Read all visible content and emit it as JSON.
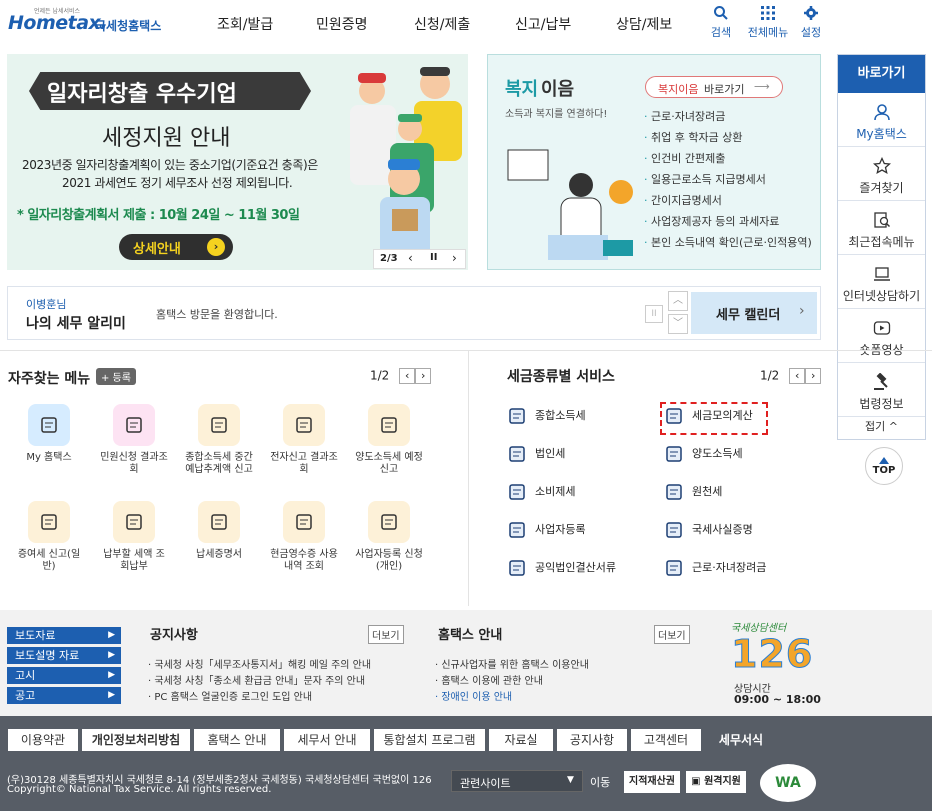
{
  "header": {
    "logo_sub": "언제든 납세서비스",
    "logo_main": "Hometax.",
    "logo_kr": "국세청홈택스",
    "gnb": [
      "조회/발급",
      "민원증명",
      "신청/제출",
      "신고/납부",
      "상담/제보"
    ],
    "util": [
      "검색",
      "전체메뉴",
      "설정"
    ]
  },
  "banner1": {
    "title": "일자리창출 우수기업",
    "subtitle": "세정지원 안내",
    "body_line1": "2023년중 일자리창출계획이 있는 중소기업(기준요건 충족)은",
    "body_line2": "2021 과세연도 정기 세무조사 선정 제외됩니다.",
    "deadline": "* 일자리창출계획서 제출 : 10월 24일 ~ 11월 30일",
    "button": "상세안내",
    "pager": "2/3"
  },
  "banner2": {
    "title_a": "복지",
    "title_b": "이음",
    "subtitle": "소득과 복지를 연결하다!",
    "link_a": "복지이음",
    "link_b": " 바로가기",
    "items": [
      "근로·자녀장려금",
      "취업 후 학자금 상환",
      "인건비 간편제출",
      "일용근로소득 지급명세서",
      "간이지급명세서",
      "사업장제공자 등의 과세자료",
      "본인 소득내역 확인(근로·인적용역)"
    ]
  },
  "quick": {
    "title": "바로가기",
    "items": [
      "My홈택스",
      "즐겨찾기",
      "최근접속메뉴",
      "인터넷상담하기",
      "숏폼영상",
      "법령정보"
    ],
    "fold": "접기 ^",
    "top": "TOP"
  },
  "notice": {
    "name": "이병훈님",
    "title": "나의 세무 알리미",
    "message": "홈택스 방문을 환영합니다.",
    "calendar": "세무 캘린더"
  },
  "favorites": {
    "title": "자주찾는 메뉴",
    "register": "+ 등록",
    "pager": "1/2",
    "items": [
      {
        "label": "My 홈택스",
        "color": "#d6ecff"
      },
      {
        "label": "민원신청 결과조회",
        "color": "#fde3f3"
      },
      {
        "label": "종합소득세 중간예납추계액 신고",
        "color": "#fdf1d8"
      },
      {
        "label": "전자신고 결과조회",
        "color": "#fdf1d8"
      },
      {
        "label": "양도소득세 예정신고",
        "color": "#fdf1d8"
      },
      {
        "label": "증여세 신고(일반)",
        "color": "#fdf1d8"
      },
      {
        "label": "납부할 세액 조회납부",
        "color": "#fdf1d8"
      },
      {
        "label": "납세증명서",
        "color": "#fdf1d8"
      },
      {
        "label": "현금영수증 사용내역 조회",
        "color": "#fdf1d8"
      },
      {
        "label": "사업자등록 신청(개인)",
        "color": "#fdf1d8"
      }
    ]
  },
  "taxservice": {
    "title": "세금종류별 서비스",
    "pager": "1/2",
    "items": [
      "종합소득세",
      "세금모의계산",
      "법인세",
      "양도소득세",
      "소비제세",
      "원천세",
      "사업자등록",
      "국세사실증명",
      "공익법인결산서류",
      "근로·자녀장려금"
    ]
  },
  "band": {
    "buttons": [
      "보도자료",
      "보도설명 자료",
      "고시",
      "공고"
    ],
    "notice_title": "공지사항",
    "notice_more": "더보기",
    "notices": [
      "국세청 사칭「세무조사통지서」해킹 메일 주의 안내",
      "국세청 사칭「종소세 환급금 안내」문자 주의 안내",
      "PC 홈택스 얼굴인증 로그인 도입 안내"
    ],
    "guide_title": "홈택스 안내",
    "guide_more": "더보기",
    "guides": [
      "신규사업자를 위한 홈택스 이용안내",
      "홈택스 이용에 관한 안내",
      "장애인 이용 안내"
    ],
    "center_label": "국세상담센터",
    "center_number": "126",
    "hours_label": "상담시간",
    "hours": "09:00 ~ 18:00"
  },
  "footer": {
    "menu": [
      "이용약관",
      "개인정보처리방침",
      "홈택스 안내",
      "세무서 안내",
      "통합설치 프로그램",
      "자료실",
      "공지사항",
      "고객센터",
      "세무서식"
    ],
    "address": "(우)30128 세종특별자치시 국세청로 8-14 (정부세종2청사 국세청동) 국세청상담센터 국번없이 126",
    "copyright": "Copyright© National Tax Service. All rights reserved.",
    "related": "관련사이트",
    "go": "이동",
    "badge1": "지적재산권",
    "badge2": "원격지원",
    "wa": "WA"
  },
  "colors": {
    "brand": "#1d5fb0",
    "accent": "#f5d21f",
    "red": "#e02020"
  }
}
